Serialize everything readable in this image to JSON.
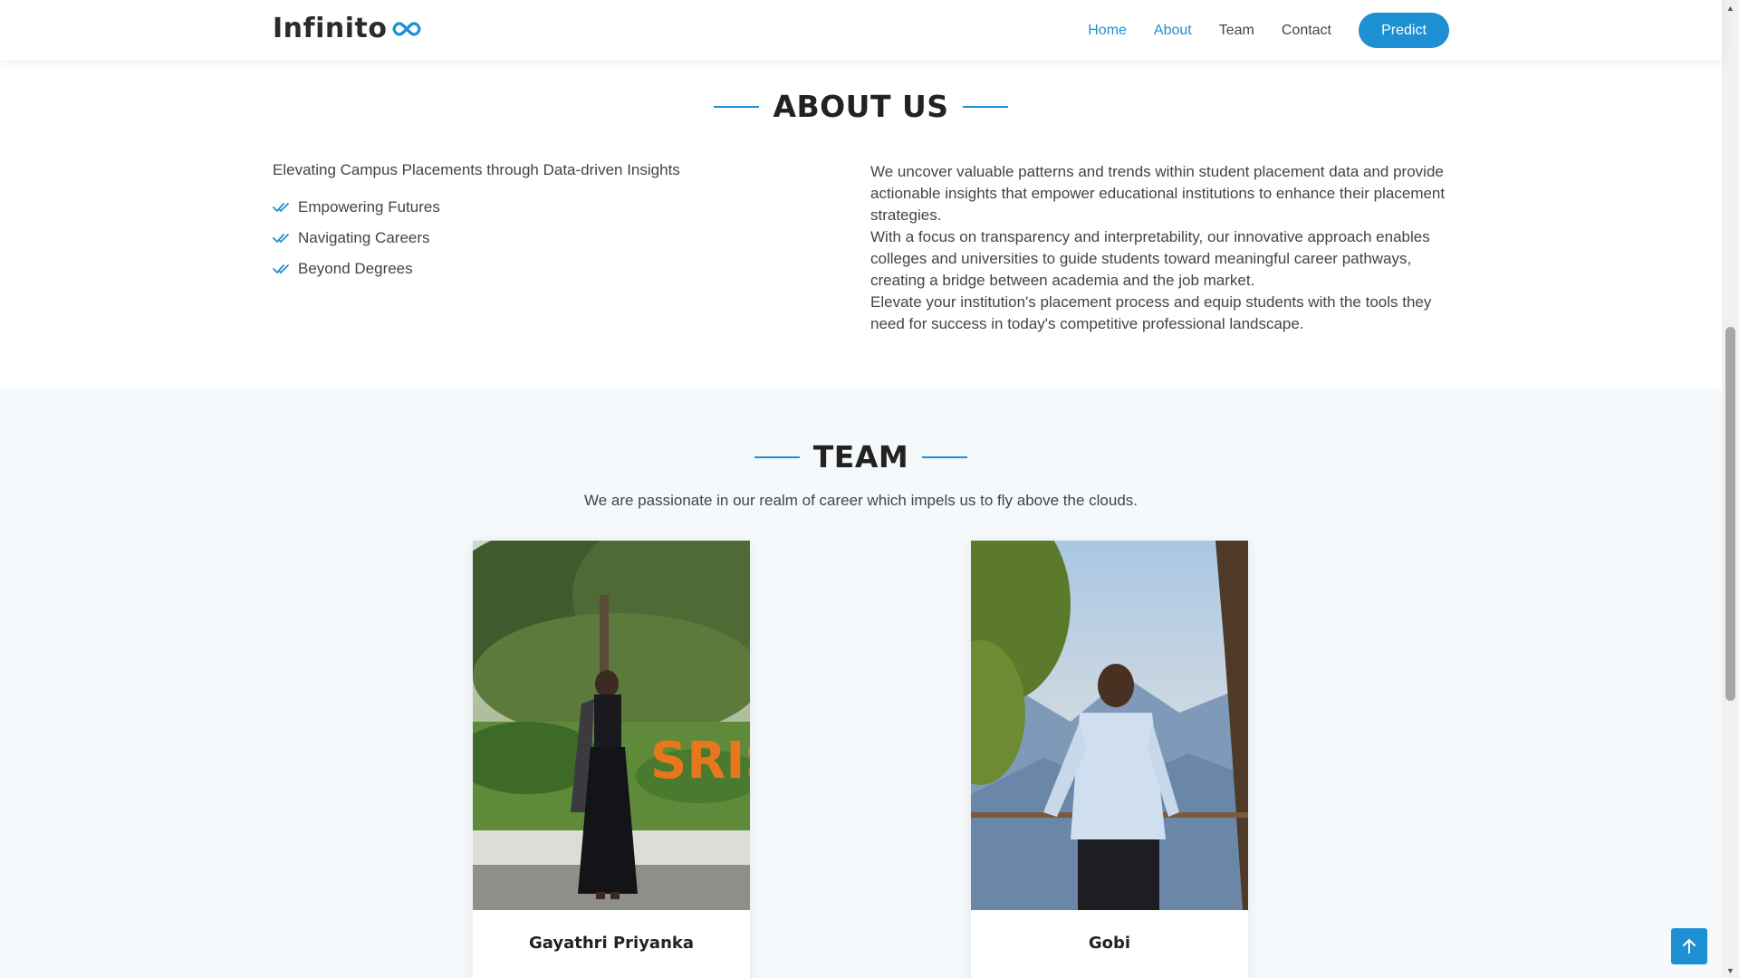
{
  "header": {
    "logo_text": "Infinito",
    "nav": [
      {
        "label": "Home",
        "active": true
      },
      {
        "label": "About",
        "active": true
      },
      {
        "label": "Team",
        "active": false
      },
      {
        "label": "Contact",
        "active": false
      }
    ],
    "predict_label": "Predict"
  },
  "about": {
    "title": "ABOUT US",
    "intro": "Elevating Campus Placements through Data-driven Insights",
    "features": [
      "Empowering Futures",
      "Navigating Careers",
      "Beyond Degrees"
    ],
    "paragraphs": [
      "We uncover valuable patterns and trends within student placement data and provide actionable insights that empower educational institutions to enhance their placement strategies.",
      "With a focus on transparency and interpretability, our innovative approach enables colleges and universities to guide students toward meaningful career pathways, creating a bridge between academia and the job market.",
      "Elevate your institution's placement process and equip students with the tools they need for success in today's competitive professional landscape."
    ]
  },
  "team": {
    "title": "TEAM",
    "subtitle": "We are passionate in our realm of career which impels us to fly above the clouds.",
    "members": [
      {
        "name": "Gayathri Priyanka"
      },
      {
        "name": "Gobi"
      }
    ]
  },
  "colors": {
    "accent": "#1d8fd3",
    "heading": "#222222",
    "team_bg": "#f6f9fb"
  }
}
